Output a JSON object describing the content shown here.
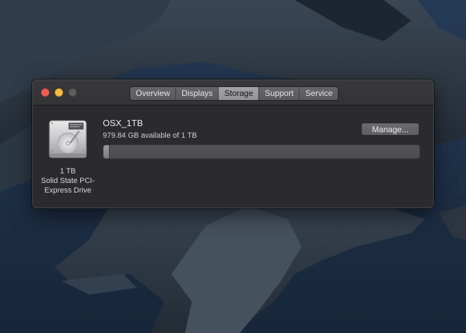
{
  "window": {
    "tabs": [
      {
        "label": "Overview",
        "active": false
      },
      {
        "label": "Displays",
        "active": false
      },
      {
        "label": "Storage",
        "active": true
      },
      {
        "label": "Support",
        "active": false
      },
      {
        "label": "Service",
        "active": false
      }
    ]
  },
  "storage": {
    "drive_icon": "internal-drive-icon",
    "drive_caption": {
      "capacity": "1 TB",
      "type_line1": "Solid State PCI-",
      "type_line2": "Express Drive"
    },
    "disk_name": "OSX_1TB",
    "available_text": "979.84 GB available of 1 TB",
    "manage_label": "Manage...",
    "used_fraction": 0.02
  },
  "colors": {
    "close": "#ed5d55",
    "minimize": "#f4bd41",
    "zoom_inactive": "#5e5e60",
    "active_tab": "#9b9b9d"
  }
}
